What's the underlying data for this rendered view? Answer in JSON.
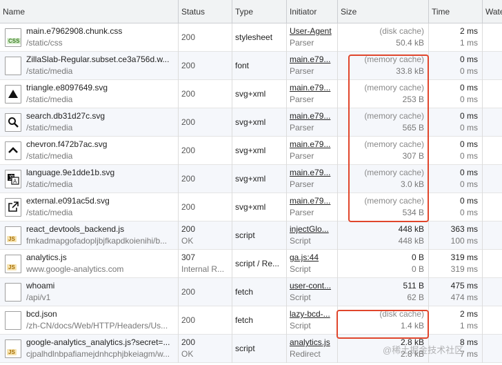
{
  "columns": {
    "name": "Name",
    "status": "Status",
    "type": "Type",
    "initiator": "Initiator",
    "size": "Size",
    "time": "Time",
    "waterfall": "Wate"
  },
  "rows": [
    {
      "icon": "css-file-icon",
      "name": "main.e7962908.chunk.css",
      "path": "/static/css",
      "status": "200",
      "status_text": "",
      "type": "stylesheet",
      "initiator": "User-Agent",
      "initiator_sub": "Parser",
      "size1": "(disk cache)",
      "size2": "50.4 kB",
      "time1": "2 ms",
      "time2": "1 ms"
    },
    {
      "icon": "blank-file-icon",
      "name": "ZillaSlab-Regular.subset.ce3a756d.w...",
      "path": "/static/media",
      "status": "200",
      "status_text": "",
      "type": "font",
      "initiator": "main.e79...",
      "initiator_sub": "Parser",
      "size1": "(memory cache)",
      "size2": "33.8 kB",
      "time1": "0 ms",
      "time2": "0 ms"
    },
    {
      "icon": "triangle-icon",
      "name": "triangle.e8097649.svg",
      "path": "/static/media",
      "status": "200",
      "status_text": "",
      "type": "svg+xml",
      "initiator": "main.e79...",
      "initiator_sub": "Parser",
      "size1": "(memory cache)",
      "size2": "253 B",
      "time1": "0 ms",
      "time2": "0 ms"
    },
    {
      "icon": "search-icon",
      "name": "search.db31d27c.svg",
      "path": "/static/media",
      "status": "200",
      "status_text": "",
      "type": "svg+xml",
      "initiator": "main.e79...",
      "initiator_sub": "Parser",
      "size1": "(memory cache)",
      "size2": "565 B",
      "time1": "0 ms",
      "time2": "0 ms"
    },
    {
      "icon": "chevron-up-icon",
      "name": "chevron.f472b7ac.svg",
      "path": "/static/media",
      "status": "200",
      "status_text": "",
      "type": "svg+xml",
      "initiator": "main.e79...",
      "initiator_sub": "Parser",
      "size1": "(memory cache)",
      "size2": "307 B",
      "time1": "0 ms",
      "time2": "0 ms"
    },
    {
      "icon": "language-icon",
      "name": "language.9e1dde1b.svg",
      "path": "/static/media",
      "status": "200",
      "status_text": "",
      "type": "svg+xml",
      "initiator": "main.e79...",
      "initiator_sub": "Parser",
      "size1": "(memory cache)",
      "size2": "3.0 kB",
      "time1": "0 ms",
      "time2": "0 ms"
    },
    {
      "icon": "external-link-icon",
      "name": "external.e091ac5d.svg",
      "path": "/static/media",
      "status": "200",
      "status_text": "",
      "type": "svg+xml",
      "initiator": "main.e79...",
      "initiator_sub": "Parser",
      "size1": "(memory cache)",
      "size2": "534 B",
      "time1": "0 ms",
      "time2": "0 ms"
    },
    {
      "icon": "js-file-icon",
      "name": "react_devtools_backend.js",
      "path": "fmkadmapgofadopljbjfkapdkoienihi/b...",
      "status": "200",
      "status_text": "OK",
      "type": "script",
      "initiator": "injectGlo...",
      "initiator_sub": "Script",
      "size1": "448 kB",
      "size2": "448 kB",
      "time1": "363 ms",
      "time2": "100 ms"
    },
    {
      "icon": "js-file-icon",
      "name": "analytics.js",
      "path": "www.google-analytics.com",
      "status": "307",
      "status_text": "Internal R...",
      "type": "script / Re...",
      "initiator": "ga.js:44",
      "initiator_sub": "Script",
      "size1": "0 B",
      "size2": "0 B",
      "time1": "319 ms",
      "time2": "319 ms"
    },
    {
      "icon": "blank-file-icon",
      "name": "whoami",
      "path": "/api/v1",
      "status": "200",
      "status_text": "",
      "type": "fetch",
      "initiator": "user-cont...",
      "initiator_sub": "Script",
      "size1": "511 B",
      "size2": "62 B",
      "time1": "475 ms",
      "time2": "474 ms"
    },
    {
      "icon": "blank-file-icon",
      "name": "bcd.json",
      "path": "/zh-CN/docs/Web/HTTP/Headers/Us...",
      "status": "200",
      "status_text": "",
      "type": "fetch",
      "initiator": "lazy-bcd-...",
      "initiator_sub": "Script",
      "size1": "(disk cache)",
      "size2": "1.4 kB",
      "time1": "2 ms",
      "time2": "1 ms"
    },
    {
      "icon": "js-file-icon",
      "name": "google-analytics_analytics.js?secret=...",
      "path": "cjpalhdlnbpafiamejdnhcphjbkeiagm/w...",
      "status": "200",
      "status_text": "OK",
      "type": "script",
      "initiator": "analytics.js",
      "initiator_sub": "Redirect",
      "size1": "2.8 kB",
      "size2": "2.8 kB",
      "time1": "8 ms",
      "time2": "7 ms"
    }
  ],
  "watermark": "@稀土掘金技术社区",
  "colors": {
    "highlight": "#e0452b",
    "header_bg": "#f1f3f4",
    "row_alt_bg": "#f5f7fb"
  }
}
